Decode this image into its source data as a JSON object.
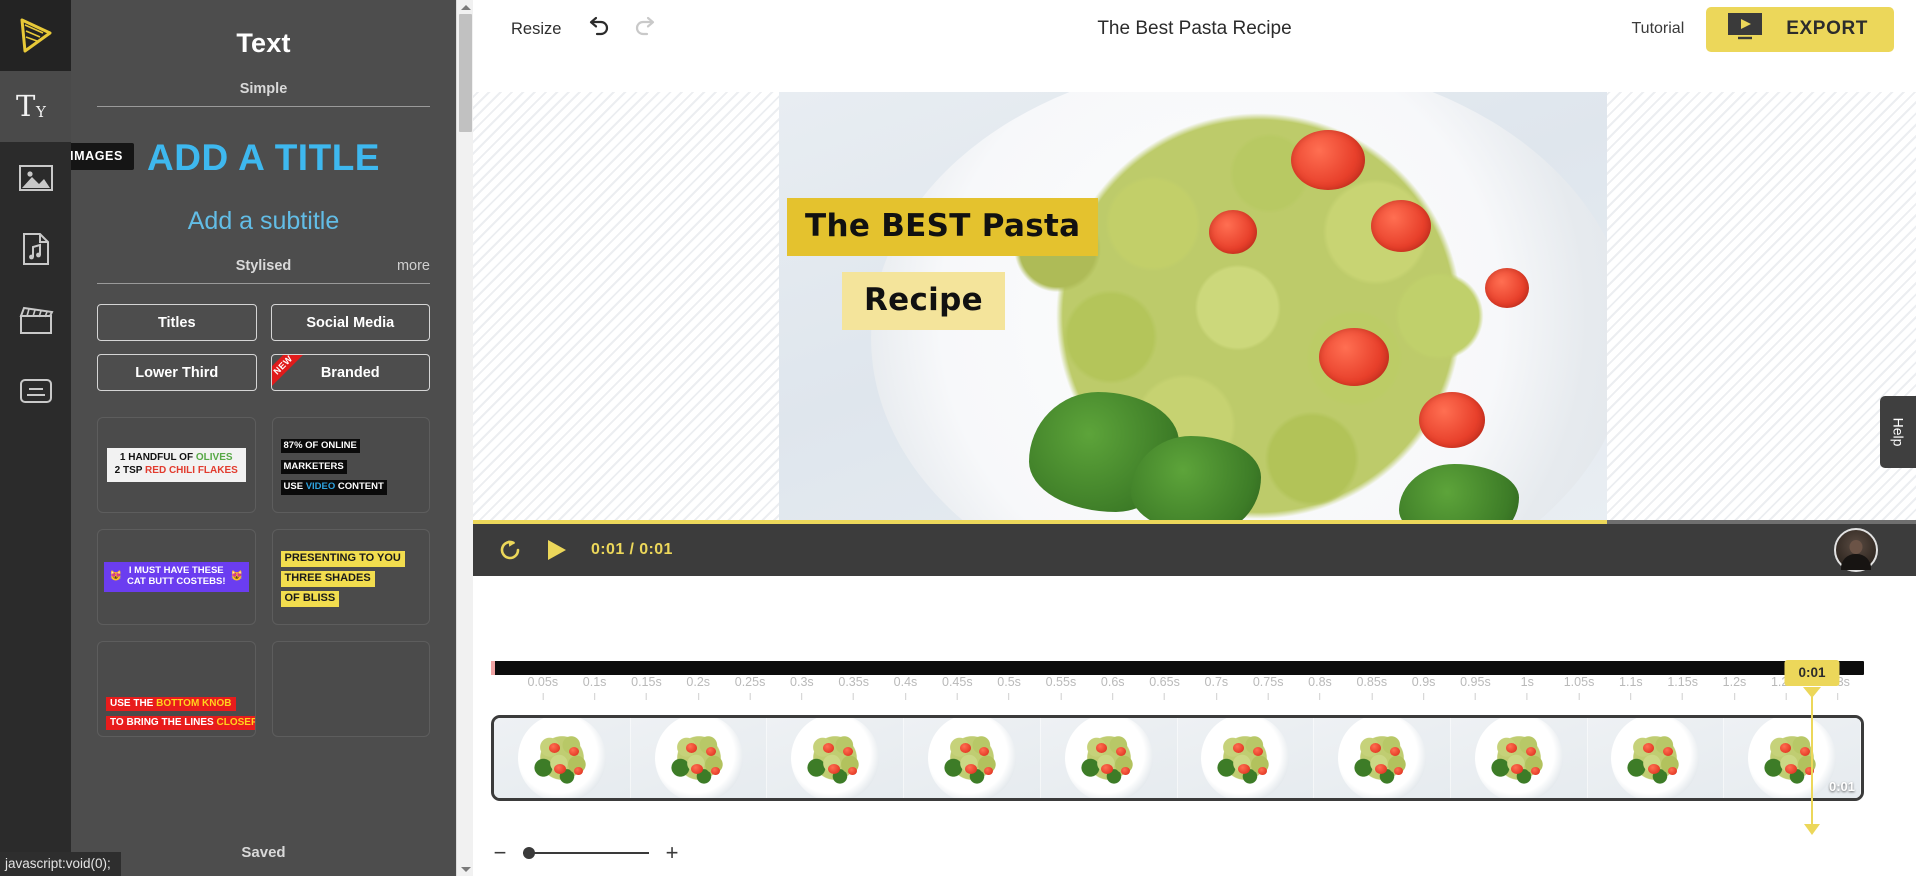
{
  "rail": {
    "items": [
      {
        "name": "logo",
        "icon": "play-triangle-logo-icon",
        "label": ""
      },
      {
        "name": "text",
        "icon": "text-tool-icon",
        "label": ""
      },
      {
        "name": "images",
        "icon": "image-icon",
        "label": ""
      },
      {
        "name": "audio",
        "icon": "audio-file-icon",
        "label": ""
      },
      {
        "name": "video",
        "icon": "clapperboard-icon",
        "label": ""
      },
      {
        "name": "subtitles",
        "icon": "subtitles-icon",
        "label": ""
      }
    ],
    "tooltip": "IMAGES"
  },
  "panel": {
    "title": "Text",
    "simple_section": "Simple",
    "add_title": "ADD A TITLE",
    "add_subtitle": "Add a subtitle",
    "stylised_section": "Stylised",
    "more_link": "more",
    "categories": [
      {
        "label": "Titles",
        "badge": ""
      },
      {
        "label": "Social Media",
        "badge": ""
      },
      {
        "label": "Lower Third",
        "badge": ""
      },
      {
        "label": "Branded",
        "badge": "NEW"
      }
    ],
    "templates": [
      {
        "id": "ingredients",
        "lines": [
          [
            {
              "t": "1 HANDFUL OF ",
              "c": "dark"
            },
            {
              "t": "OLIVES",
              "c": "green"
            }
          ],
          [
            {
              "t": "2 TSP ",
              "c": "dark"
            },
            {
              "t": "RED CHILI FLAKES",
              "c": "red"
            }
          ]
        ]
      },
      {
        "id": "marketers-stat",
        "lines": [
          [
            {
              "t": "87% OF ONLINE",
              "c": "white"
            }
          ],
          [
            {
              "t": "MARKETERS",
              "c": "blue"
            }
          ],
          [
            {
              "t": "USE ",
              "c": "white"
            },
            {
              "t": "VIDEO",
              "c": "blue"
            },
            {
              "t": " CONTENT",
              "c": "white"
            }
          ]
        ]
      },
      {
        "id": "cat-butt-coasters",
        "lines": [
          [
            {
              "t": "I MUST HAVE THESE",
              "c": "white"
            }
          ],
          [
            {
              "t": "CAT BUTT COSTEBS!",
              "c": "white"
            }
          ]
        ],
        "emoji_left": "😻",
        "emoji_right": "😻"
      },
      {
        "id": "three-shades",
        "lines": [
          [
            {
              "t": "PRESENTING TO YOU",
              "c": "dark"
            }
          ],
          [
            {
              "t": "THREE SHADES",
              "c": "dark"
            }
          ],
          [
            {
              "t": "OF BLISS",
              "c": "dark"
            }
          ]
        ]
      },
      {
        "id": "bottom-knob",
        "lines": [
          [
            {
              "t": "USE THE ",
              "c": "white"
            },
            {
              "t": "BOTTOM KNOB",
              "c": "yellow"
            }
          ],
          [
            {
              "t": "TO BRING THE LINES ",
              "c": "white"
            },
            {
              "t": "CLOSER",
              "c": "yellow"
            }
          ]
        ]
      },
      {
        "id": "empty-slot",
        "lines": []
      }
    ],
    "saved_status": "Saved"
  },
  "topbar": {
    "resize_label": "Resize",
    "undo_icon": "undo-arrow-icon",
    "redo_icon": "redo-arrow-icon",
    "project_title": "The Best Pasta Recipe",
    "tutorial_label": "Tutorial",
    "export_label": "EXPORT",
    "export_icon": "export-video-icon"
  },
  "stage": {
    "overlay_title": "The BEST Pasta",
    "overlay_subtitle": "Recipe",
    "overlay_title_bg": "#e4c22e",
    "overlay_subtitle_bg": "#f4e49b"
  },
  "player": {
    "loop_icon": "loop-replay-icon",
    "play_icon": "play-icon",
    "current_time": "0:01",
    "separator": "/",
    "total_time": "0:01",
    "progress_percent": 78.6,
    "avatar": "user-avatar"
  },
  "help": {
    "label": "Help"
  },
  "timeline": {
    "ticks": [
      "0.05s",
      "0.1s",
      "0.15s",
      "0.2s",
      "0.25s",
      "0.3s",
      "0.35s",
      "0.4s",
      "0.45s",
      "0.5s",
      "0.55s",
      "0.6s",
      "0.65s",
      "0.7s",
      "0.75s",
      "0.8s",
      "0.85s",
      "0.9s",
      "0.95s",
      "1s",
      "1.05s",
      "1.1s",
      "1.15s",
      "1.2s",
      "1.25s",
      "1.3s"
    ],
    "playhead_label": "0:01",
    "clip_end_label": "0:01",
    "clip_thumb_count": 10,
    "zoom_minus": "−",
    "zoom_plus": "+",
    "zoom_value": 0
  },
  "status_bar": {
    "link_text": "javascript:void(0);"
  },
  "colors": {
    "accent_yellow": "#ecd75a",
    "panel_bg": "#4d4d4d",
    "rail_bg": "#2b2b2b",
    "title_blue": "#3eb8ef"
  }
}
